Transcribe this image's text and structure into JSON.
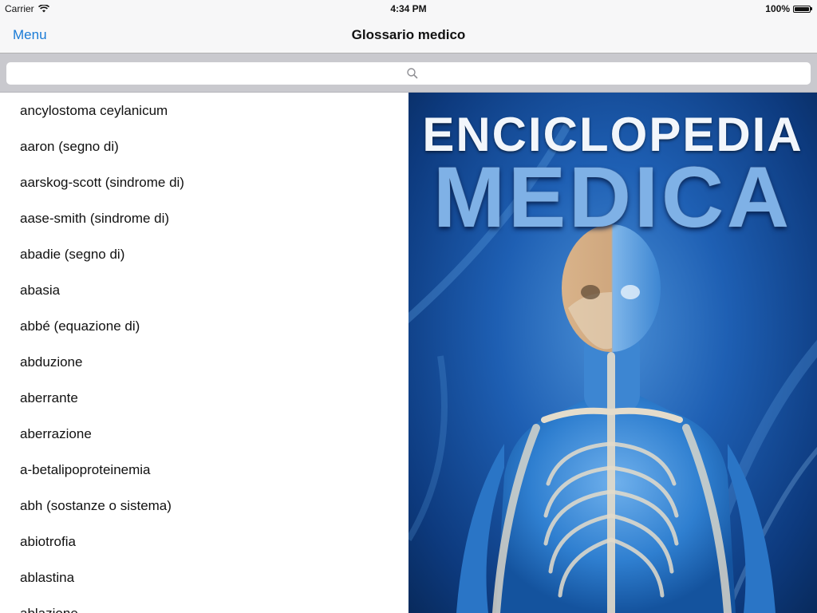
{
  "status_bar": {
    "carrier": "Carrier",
    "time": "4:34 PM",
    "battery": "100%",
    "icons": [
      "wifi-icon",
      "battery-icon"
    ]
  },
  "nav": {
    "menu_label": "Menu",
    "title": "Glossario medico"
  },
  "search": {
    "placeholder": "",
    "value": ""
  },
  "terms": [
    "ancylostoma ceylanicum",
    "aaron (segno di)",
    "aarskog-scott (sindrome di)",
    "aase-smith (sindrome di)",
    "abadie (segno di)",
    "abasia",
    "abbé (equazione di)",
    "abduzione",
    "aberrante",
    "aberrazione",
    "a-betalipoproteinemia",
    "abh (sostanze o sistema)",
    "abiotrofia",
    "ablastina",
    "ablazione"
  ],
  "cover": {
    "title_line1": "ENCICLOPEDIA",
    "title_line2": "MEDICA"
  },
  "colors": {
    "accent": "#1a7bd6",
    "cover_blue": "#1e5fb3"
  }
}
